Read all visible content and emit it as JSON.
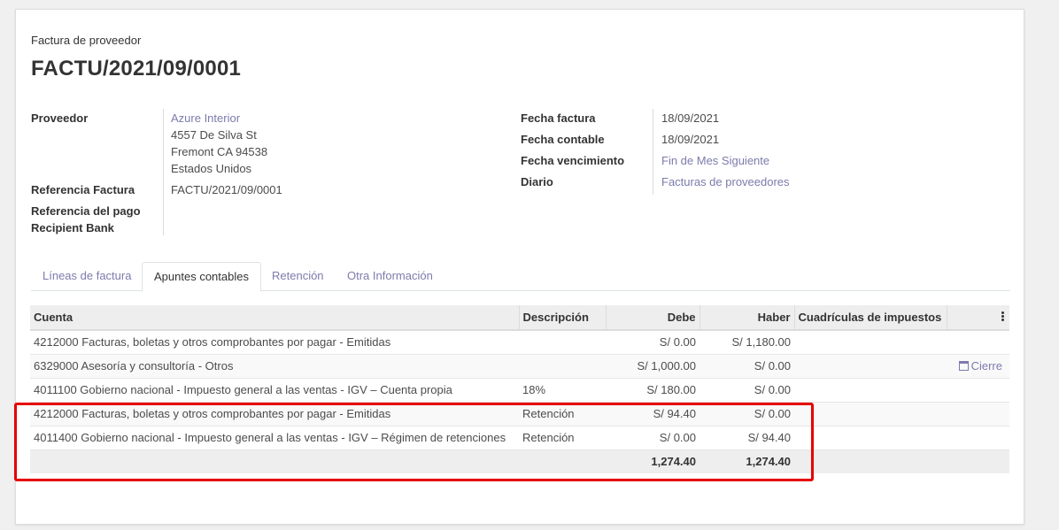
{
  "header": {
    "subtitle": "Factura de proveedor",
    "title": "FACTU/2021/09/0001"
  },
  "left_fields": {
    "proveedor_label": "Proveedor",
    "proveedor_name": "Azure Interior",
    "address_line1": "4557 De Silva St",
    "address_line2": "Fremont CA 94538",
    "address_line3": "Estados Unidos",
    "ref_factura_label": "Referencia Factura",
    "ref_factura_value": "FACTU/2021/09/0001",
    "ref_pago_label": "Referencia del pago",
    "recipient_bank_label": "Recipient Bank"
  },
  "right_fields": {
    "fecha_factura_label": "Fecha factura",
    "fecha_factura_value": "18/09/2021",
    "fecha_contable_label": "Fecha contable",
    "fecha_contable_value": "18/09/2021",
    "fecha_venc_label": "Fecha vencimiento",
    "fecha_venc_value": "Fin de Mes Siguiente",
    "diario_label": "Diario",
    "diario_value": "Facturas de proveedores"
  },
  "tabs": [
    {
      "label": "Líneas de factura",
      "active": false
    },
    {
      "label": "Apuntes contables",
      "active": true
    },
    {
      "label": "Retención",
      "active": false
    },
    {
      "label": "Otra Información",
      "active": false
    }
  ],
  "table": {
    "columns": [
      "Cuenta",
      "Descripción",
      "Debe",
      "Haber",
      "Cuadrículas de impuestos"
    ],
    "rows": [
      {
        "cuenta": "4212000 Facturas, boletas y otros comprobantes por pagar - Emitidas",
        "descripcion": "",
        "debe": "S/ 0.00",
        "haber": "S/ 1,180.00",
        "tags": ""
      },
      {
        "cuenta": "6329000 Asesoría y consultoría - Otros",
        "descripcion": "",
        "debe": "S/ 1,000.00",
        "haber": "S/ 0.00",
        "tags": "Cierre"
      },
      {
        "cuenta": "4011100 Gobierno nacional - Impuesto general a las ventas - IGV – Cuenta propia",
        "descripcion": "18%",
        "debe": "S/ 180.00",
        "haber": "S/ 0.00",
        "tags": ""
      },
      {
        "cuenta": "4212000 Facturas, boletas y otros comprobantes por pagar - Emitidas",
        "descripcion": "Retención",
        "debe": "S/ 94.40",
        "haber": "S/ 0.00",
        "tags": ""
      },
      {
        "cuenta": "4011400 Gobierno nacional - Impuesto general a las ventas - IGV – Régimen de retenciones",
        "descripcion": "Retención",
        "debe": "S/ 0.00",
        "haber": "S/ 94.40",
        "tags": ""
      }
    ],
    "total_debe": "1,274.40",
    "total_haber": "1,274.40"
  },
  "colors": {
    "link": "#7c7bad",
    "highlight": "#e60000"
  }
}
